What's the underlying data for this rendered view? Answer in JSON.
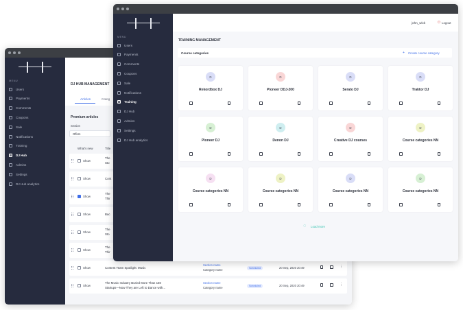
{
  "back_window": {
    "sidebar": {
      "menu_label": "MENU",
      "items": [
        {
          "label": "Users",
          "icon": "user-icon"
        },
        {
          "label": "Payments",
          "icon": "card-icon"
        },
        {
          "label": "Comments",
          "icon": "comment-icon"
        },
        {
          "label": "Coupons",
          "icon": "coupon-icon"
        },
        {
          "label": "Sale",
          "icon": "cart-icon"
        },
        {
          "label": "Notifications",
          "icon": "bell-icon"
        },
        {
          "label": "Training",
          "icon": "monitor-icon"
        },
        {
          "label": "DJ Hub",
          "icon": "hub-icon",
          "active": true
        },
        {
          "label": "Admins",
          "icon": "admin-icon"
        },
        {
          "label": "Settings",
          "icon": "gear-icon"
        },
        {
          "label": "DJ Hub analytics",
          "icon": "analytics-icon"
        }
      ]
    },
    "header": {
      "title": "DJ HUB MANAGEMENT"
    },
    "tabs": [
      "Articles",
      "Categ"
    ],
    "section_title": "Premium articles",
    "section_label": "Section",
    "section_select_value": "Offers",
    "columns": {
      "whats_new": "What's new",
      "title": "Title"
    },
    "rows": [
      {
        "show": "Show",
        "checked": false,
        "title1": "The",
        "title2": "Sto"
      },
      {
        "show": "Show",
        "checked": false,
        "title1": "Cont",
        "title2": ""
      },
      {
        "show": "Show",
        "checked": true,
        "title1": "The",
        "title2": "Thir"
      },
      {
        "show": "Show",
        "checked": false,
        "title1": "Bac",
        "title2": ""
      },
      {
        "show": "Show",
        "checked": false,
        "title1": "The",
        "title2": "Sto"
      },
      {
        "show": "Show",
        "checked": false,
        "title1": "The",
        "title2": "Thir"
      },
      {
        "show": "Show",
        "checked": false,
        "title1": "Content Team Spotlight: Music",
        "title2": "",
        "section": "Section name",
        "category": "Category name",
        "status": "Scheduled",
        "date": "20 Sep, 2020 20:49"
      },
      {
        "show": "Show",
        "checked": false,
        "title1": "The Music Industry Buried More Than 150",
        "title2": "Startups—Now They are Left to Dance with...",
        "section": "Section name",
        "category": "Category name",
        "status": "Scheduled",
        "date": "20 Sep, 2020 20:49"
      }
    ]
  },
  "front_window": {
    "sidebar": {
      "menu_label": "MENU",
      "items": [
        {
          "label": "Users",
          "icon": "user-icon"
        },
        {
          "label": "Payments",
          "icon": "card-icon"
        },
        {
          "label": "Comments",
          "icon": "comment-icon"
        },
        {
          "label": "Coupons",
          "icon": "coupon-icon"
        },
        {
          "label": "Sale",
          "icon": "cart-icon"
        },
        {
          "label": "Notifications",
          "icon": "bell-icon"
        },
        {
          "label": "Training",
          "icon": "monitor-icon",
          "active": true
        },
        {
          "label": "DJ Hub",
          "icon": "hub-icon"
        },
        {
          "label": "Admins",
          "icon": "admin-icon"
        },
        {
          "label": "Settings",
          "icon": "gear-icon"
        },
        {
          "label": "DJ Hub analytics",
          "icon": "analytics-icon"
        }
      ]
    },
    "topbar": {
      "username": "john_wick",
      "logout": "Logout"
    },
    "page_title": "TRAINING MANAGEMENT",
    "categories_label": "Course categories",
    "create_label": "Create course category",
    "cards": [
      {
        "title": "Rekordbox DJ",
        "initial": "D",
        "color": "#d9ddf7"
      },
      {
        "title": "Pioneer DDJ-200",
        "initial": "D",
        "color": "#f9d6d6"
      },
      {
        "title": "Serato DJ",
        "initial": "D",
        "color": "#d9ddf7"
      },
      {
        "title": "Traktor DJ",
        "initial": "D",
        "color": "#d9ddf7"
      },
      {
        "title": "Pioneer DJ",
        "initial": "D",
        "color": "#d7f0d4"
      },
      {
        "title": "Denon DJ",
        "initial": "D",
        "color": "#cfeef0"
      },
      {
        "title": "Creative DJ courses",
        "initial": "D",
        "color": "#f9d6d6"
      },
      {
        "title": "Course categories NN",
        "initial": "D",
        "color": "#eef2c5"
      },
      {
        "title": "Course categories NN",
        "initial": "D",
        "color": "#f6e0f2"
      },
      {
        "title": "Course categories NN",
        "initial": "D",
        "color": "#eef2c5"
      },
      {
        "title": "Course categories NN",
        "initial": "D",
        "color": "#d9ddf7"
      },
      {
        "title": "Course categories NN",
        "initial": "D",
        "color": "#d7f0d4"
      }
    ],
    "load_more": "Load more",
    "colors": {
      "accent": "#3f6ee8",
      "sidebar": "#262b3e",
      "load_more": "#36c4b0"
    }
  }
}
